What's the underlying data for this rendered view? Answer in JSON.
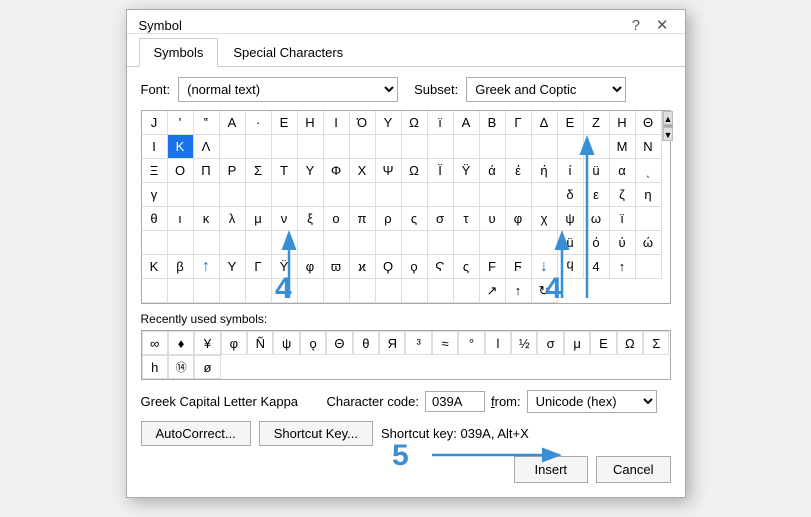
{
  "dialog": {
    "title": "Symbol",
    "help_icon": "?",
    "close_icon": "✕"
  },
  "tabs": [
    {
      "id": "symbols",
      "label": "Symbols",
      "active": true
    },
    {
      "id": "special-chars",
      "label": "Special Characters",
      "active": false
    }
  ],
  "font": {
    "label": "Font:",
    "value": "(normal text)"
  },
  "subset": {
    "label": "Subset:",
    "value": "Greek and Coptic"
  },
  "symbols": [
    "J",
    "'",
    "‟",
    "Α",
    "·",
    "Ε",
    "Η",
    "Ι",
    "Ό",
    "Υ",
    "Ω",
    "ï",
    "Α",
    "Β",
    "Γ",
    "Δ",
    "Ε",
    "Ζ",
    "Η",
    "Θ",
    "Μ",
    "Ν",
    "Ξ",
    "Ο",
    "Π",
    "Ρ",
    "Σ",
    "Τ",
    "Υ",
    "Φ",
    "Χ",
    "Ψ",
    "Ω",
    "Ï",
    "Ÿ",
    "ά",
    "έ",
    "ή",
    "ί",
    "ü",
    "δ",
    "ε",
    "ζ",
    "η",
    "θ",
    "ι",
    "κ",
    "λ",
    "μ",
    "ν",
    "ξ",
    "ο",
    "π",
    "ρ",
    "ς",
    "σ",
    "τ",
    "υ",
    "φ",
    "χ",
    "ü",
    "ό",
    "ύ",
    "ώ",
    "Κ",
    "β",
    "↑",
    "Υ",
    "Γ",
    "Ϋ",
    "φ",
    "ϖ",
    "ϰ",
    "Ϙ",
    "ϙ",
    "Ϛ",
    "ς",
    "F",
    "Ϝ",
    "ϥ"
  ],
  "selected_index": 64,
  "row4_special_index": 4,
  "symbols_row1": [
    "J",
    "'",
    "‟",
    "Α",
    "·",
    "Ε",
    "Η",
    "Ι",
    "Ό",
    "Υ",
    "Ω",
    "ï",
    "Α",
    "Β",
    "Γ",
    "Δ",
    "Ε",
    "Ζ",
    "Η",
    "Θ"
  ],
  "symbols_row1_end": [
    "Ι",
    "Κ",
    "Λ"
  ],
  "symbols_row2": [
    "Μ",
    "Ν",
    "Ξ",
    "Ο",
    "Π",
    "Ρ",
    "Σ",
    "Τ",
    "Υ",
    "Φ",
    "Χ",
    "Ψ",
    "Ω",
    "Ï",
    "Ÿ",
    "ά",
    "έ",
    "ή",
    "ί",
    "ü"
  ],
  "symbols_row2_end": [
    "α",
    "ͺ",
    "γ"
  ],
  "symbols_row3": [
    "δ",
    "ε",
    "ζ",
    "η",
    "θ",
    "ι",
    "κ",
    "λ",
    "μ",
    "ν",
    "ξ",
    "ο",
    "π",
    "ρ",
    "ς",
    "σ",
    "τ",
    "υ",
    "φ",
    "χ"
  ],
  "symbols_row3_end": [
    "ψ",
    "ω",
    "ï"
  ],
  "symbols_row4": [
    "ü",
    "ό",
    "ύ",
    "ώ",
    "Κ",
    "β",
    "↑",
    "Υ",
    "Γ",
    "Ϋ",
    "φ",
    "ϖ",
    "ϰ",
    "Ϙ",
    "ϙ",
    "Ϛ",
    "ς",
    "F",
    "Ϝ",
    "↓"
  ],
  "recently_used_label": "Recently used symbols:",
  "recently_used": [
    "∞",
    "♦",
    "¥",
    "φ",
    "Ñ",
    "ψ",
    "ǫ",
    "Θ",
    "θ",
    "Я",
    "³",
    "≈",
    "°",
    "l",
    "½",
    "σ",
    "μ",
    "Ε",
    "Ω",
    "Σ",
    "h",
    "⑭",
    "ø"
  ],
  "char_name": "Greek Capital Letter Kappa",
  "char_code_label": "Character code:",
  "char_code_value": "039A",
  "from_label": "from:",
  "from_value": "Unicode (hex)",
  "autocorrect_label": "AutoCorrect...",
  "shortcut_key_label": "Shortcut Key...",
  "shortcut_key_text": "Shortcut key: 039A, Alt+X",
  "insert_label": "Insert",
  "cancel_label": "Cancel",
  "annotation_4a": "4",
  "annotation_4b": "4",
  "annotation_5": "5"
}
